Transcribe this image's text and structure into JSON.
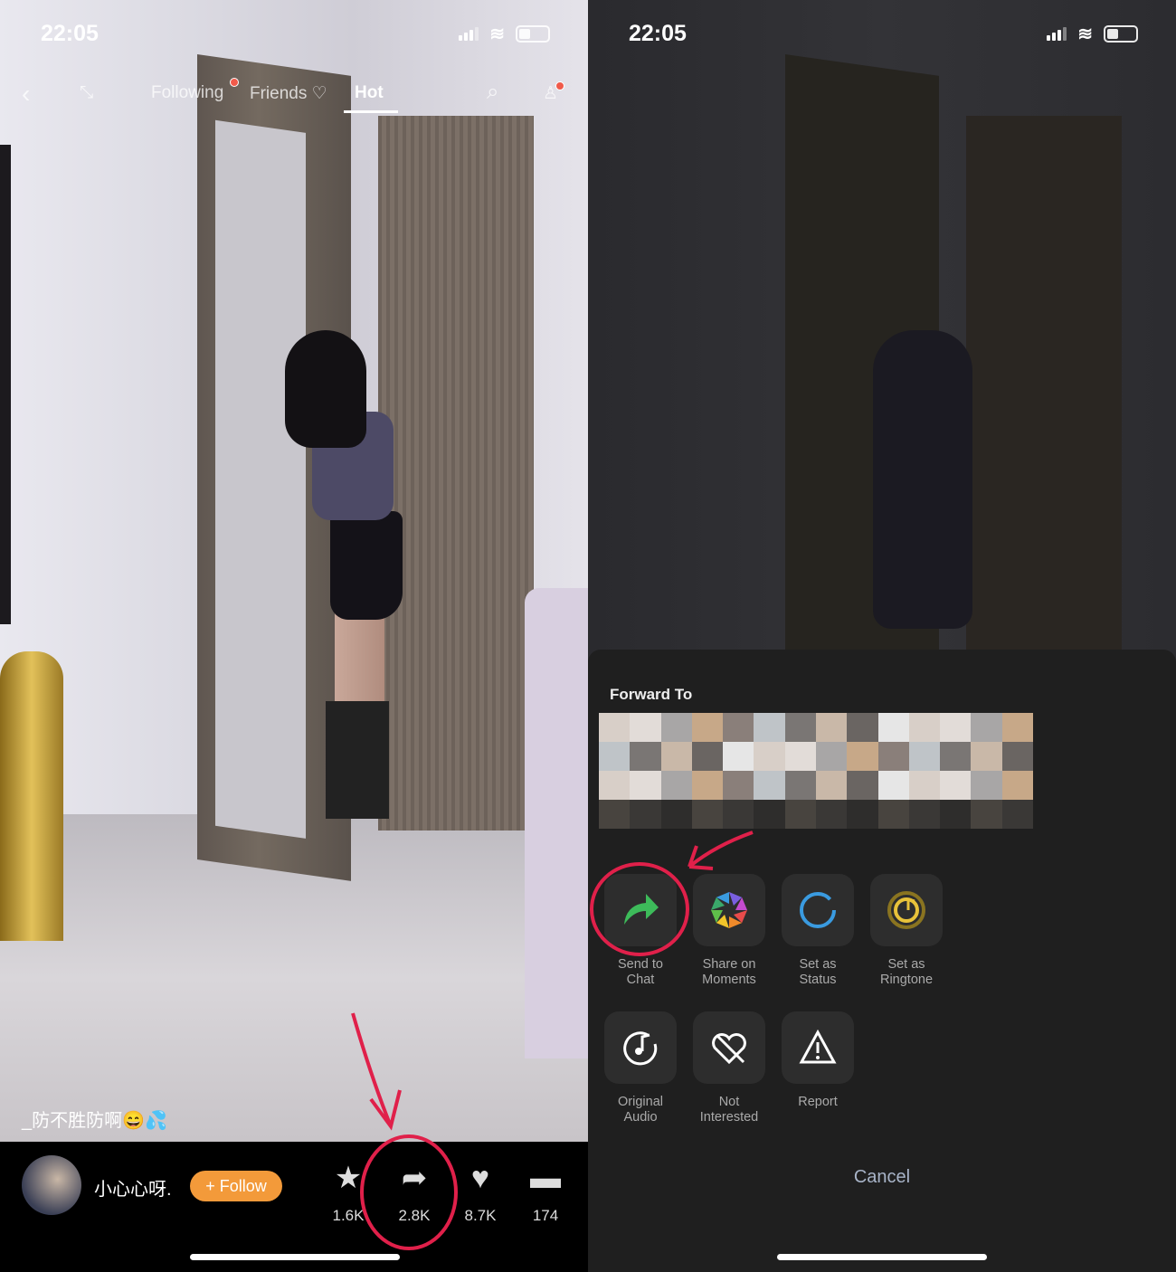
{
  "status_bar": {
    "time": "22:05"
  },
  "left": {
    "nav": {
      "tabs": [
        {
          "label": "Following"
        },
        {
          "label": "Friends ♡"
        },
        {
          "label": "Hot"
        }
      ],
      "active_tab": "Hot"
    },
    "caption": "_防不胜防啊😄💦",
    "author": {
      "name": "小心心呀.",
      "follow_label": "+ Follow"
    },
    "actions": [
      {
        "icon": "star-icon",
        "count": "1.6K"
      },
      {
        "icon": "share-icon",
        "count": "2.8K"
      },
      {
        "icon": "heart-icon",
        "count": "8.7K"
      },
      {
        "icon": "comment-icon",
        "count": "174"
      }
    ]
  },
  "right": {
    "sheet": {
      "title": "Forward To",
      "options": [
        {
          "label": "Send to Chat",
          "icon": "forward-arrow-icon",
          "color": "#3dbb5a"
        },
        {
          "label": "Share on Moments",
          "icon": "aperture-icon"
        },
        {
          "label": "Set as Status",
          "icon": "ring-icon",
          "color": "#3a9be0"
        },
        {
          "label": "Set as Ringtone",
          "icon": "ringtone-icon",
          "color": "#e8c23a"
        },
        {
          "label": "Original Audio",
          "icon": "music-note-icon"
        },
        {
          "label": "Not Interested",
          "icon": "broken-heart-icon"
        },
        {
          "label": "Report",
          "icon": "warning-icon"
        }
      ],
      "cancel_label": "Cancel"
    }
  },
  "colors": {
    "annotation": "#e0204a",
    "follow": "#f39a3a"
  }
}
